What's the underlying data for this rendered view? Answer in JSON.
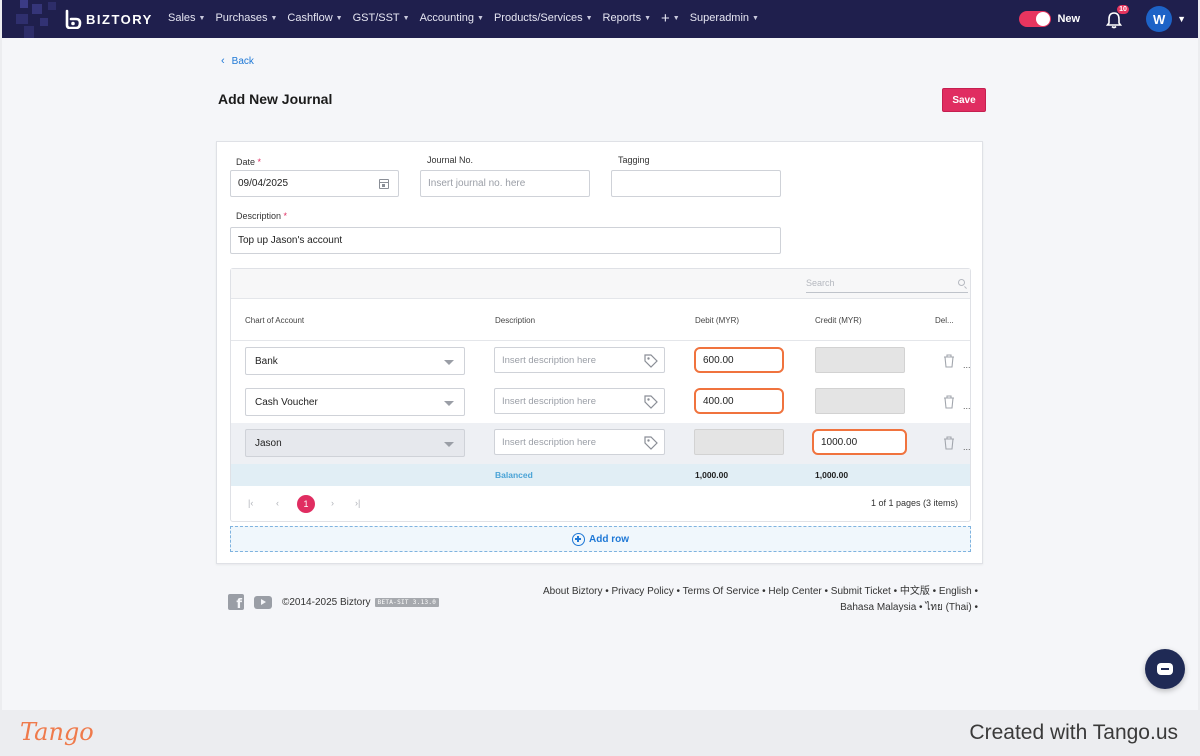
{
  "nav": {
    "brand": "BIZTORY",
    "menu": [
      "Sales",
      "Purchases",
      "Cashflow",
      "GST/SST",
      "Accounting",
      "Products/Services",
      "Reports",
      "+",
      "Superadmin"
    ],
    "toggle_label": "New",
    "notification_count": "10",
    "avatar_initial": "W"
  },
  "page": {
    "back_label": "Back",
    "title": "Add New Journal",
    "save_label": "Save"
  },
  "form": {
    "date_label": "Date",
    "date_value": "09/04/2025",
    "journal_no_label": "Journal No.",
    "journal_no_placeholder": "Insert journal no. here",
    "tagging_label": "Tagging",
    "description_label": "Description",
    "description_value": "Top up Jason's account",
    "required_mark": "*"
  },
  "grid": {
    "search_placeholder": "Search",
    "headers": {
      "account": "Chart of Account",
      "description": "Description",
      "debit": "Debit (MYR)",
      "credit": "Credit (MYR)",
      "delete": "Del..."
    },
    "rows": [
      {
        "account": "Bank",
        "description_placeholder": "Insert description here",
        "debit": "600.00",
        "credit": "",
        "more": "..."
      },
      {
        "account": "Cash Voucher",
        "description_placeholder": "Insert description here",
        "debit": "400.00",
        "credit": "",
        "more": "..."
      },
      {
        "account": "Jason",
        "description_placeholder": "Insert description here",
        "debit": "",
        "credit": "1000.00",
        "more": "..."
      }
    ],
    "balance": {
      "status": "Balanced",
      "debit_total": "1,000.00",
      "credit_total": "1,000.00"
    },
    "pager": {
      "current_page": "1",
      "info": "1 of 1 pages (3 items)"
    },
    "add_row_label": "Add row"
  },
  "footer": {
    "copyright": "©2014-2025 Biztory",
    "version_badge": "BETA-SIT 3.13.0",
    "links_line1": "About Biztory • Privacy Policy • Terms Of Service • Help Center • Submit Ticket • 中文版 • English •",
    "links_line2": "Bahasa Malaysia • ไทย (Thai) •"
  },
  "tango": {
    "logo": "Tango",
    "credit": "Created with Tango.us"
  },
  "colors": {
    "nav_bg": "#1f1f4d",
    "accent": "#e02d61",
    "highlight": "#f0733e",
    "link": "#1e78d6"
  }
}
